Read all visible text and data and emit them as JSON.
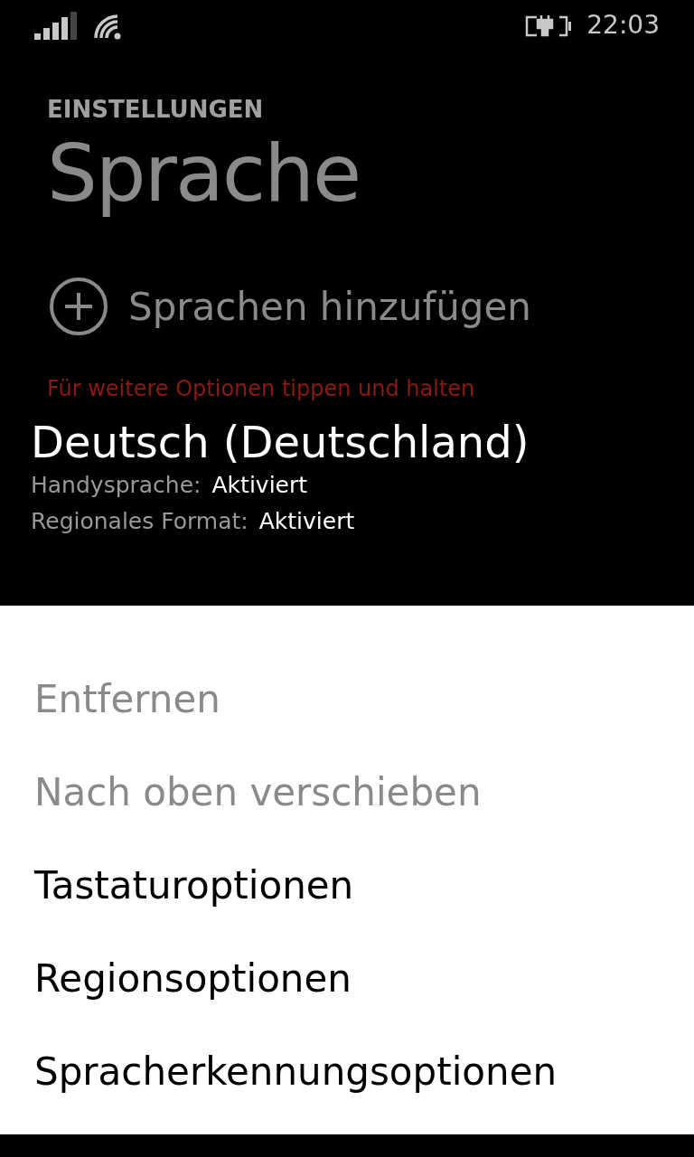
{
  "status_bar": {
    "time": "22:03"
  },
  "header": {
    "app_title": "EINSTELLUNGEN",
    "page_title": "Sprache"
  },
  "add_button": {
    "label": "Sprachen hinzufügen"
  },
  "hint": "Für weitere Optionen tippen und halten",
  "language": {
    "name": "Deutsch (Deutschland)",
    "details": [
      {
        "label": "Handysprache:",
        "value": "Aktiviert"
      },
      {
        "label": "Regionales Format:",
        "value": "Aktiviert"
      }
    ]
  },
  "context_menu": [
    {
      "label": "Entfernen",
      "disabled": true
    },
    {
      "label": "Nach oben verschieben",
      "disabled": true
    },
    {
      "label": "Tastaturoptionen",
      "disabled": false
    },
    {
      "label": "Regionsoptionen",
      "disabled": false
    },
    {
      "label": "Spracherkennungsoptionen",
      "disabled": false
    }
  ]
}
